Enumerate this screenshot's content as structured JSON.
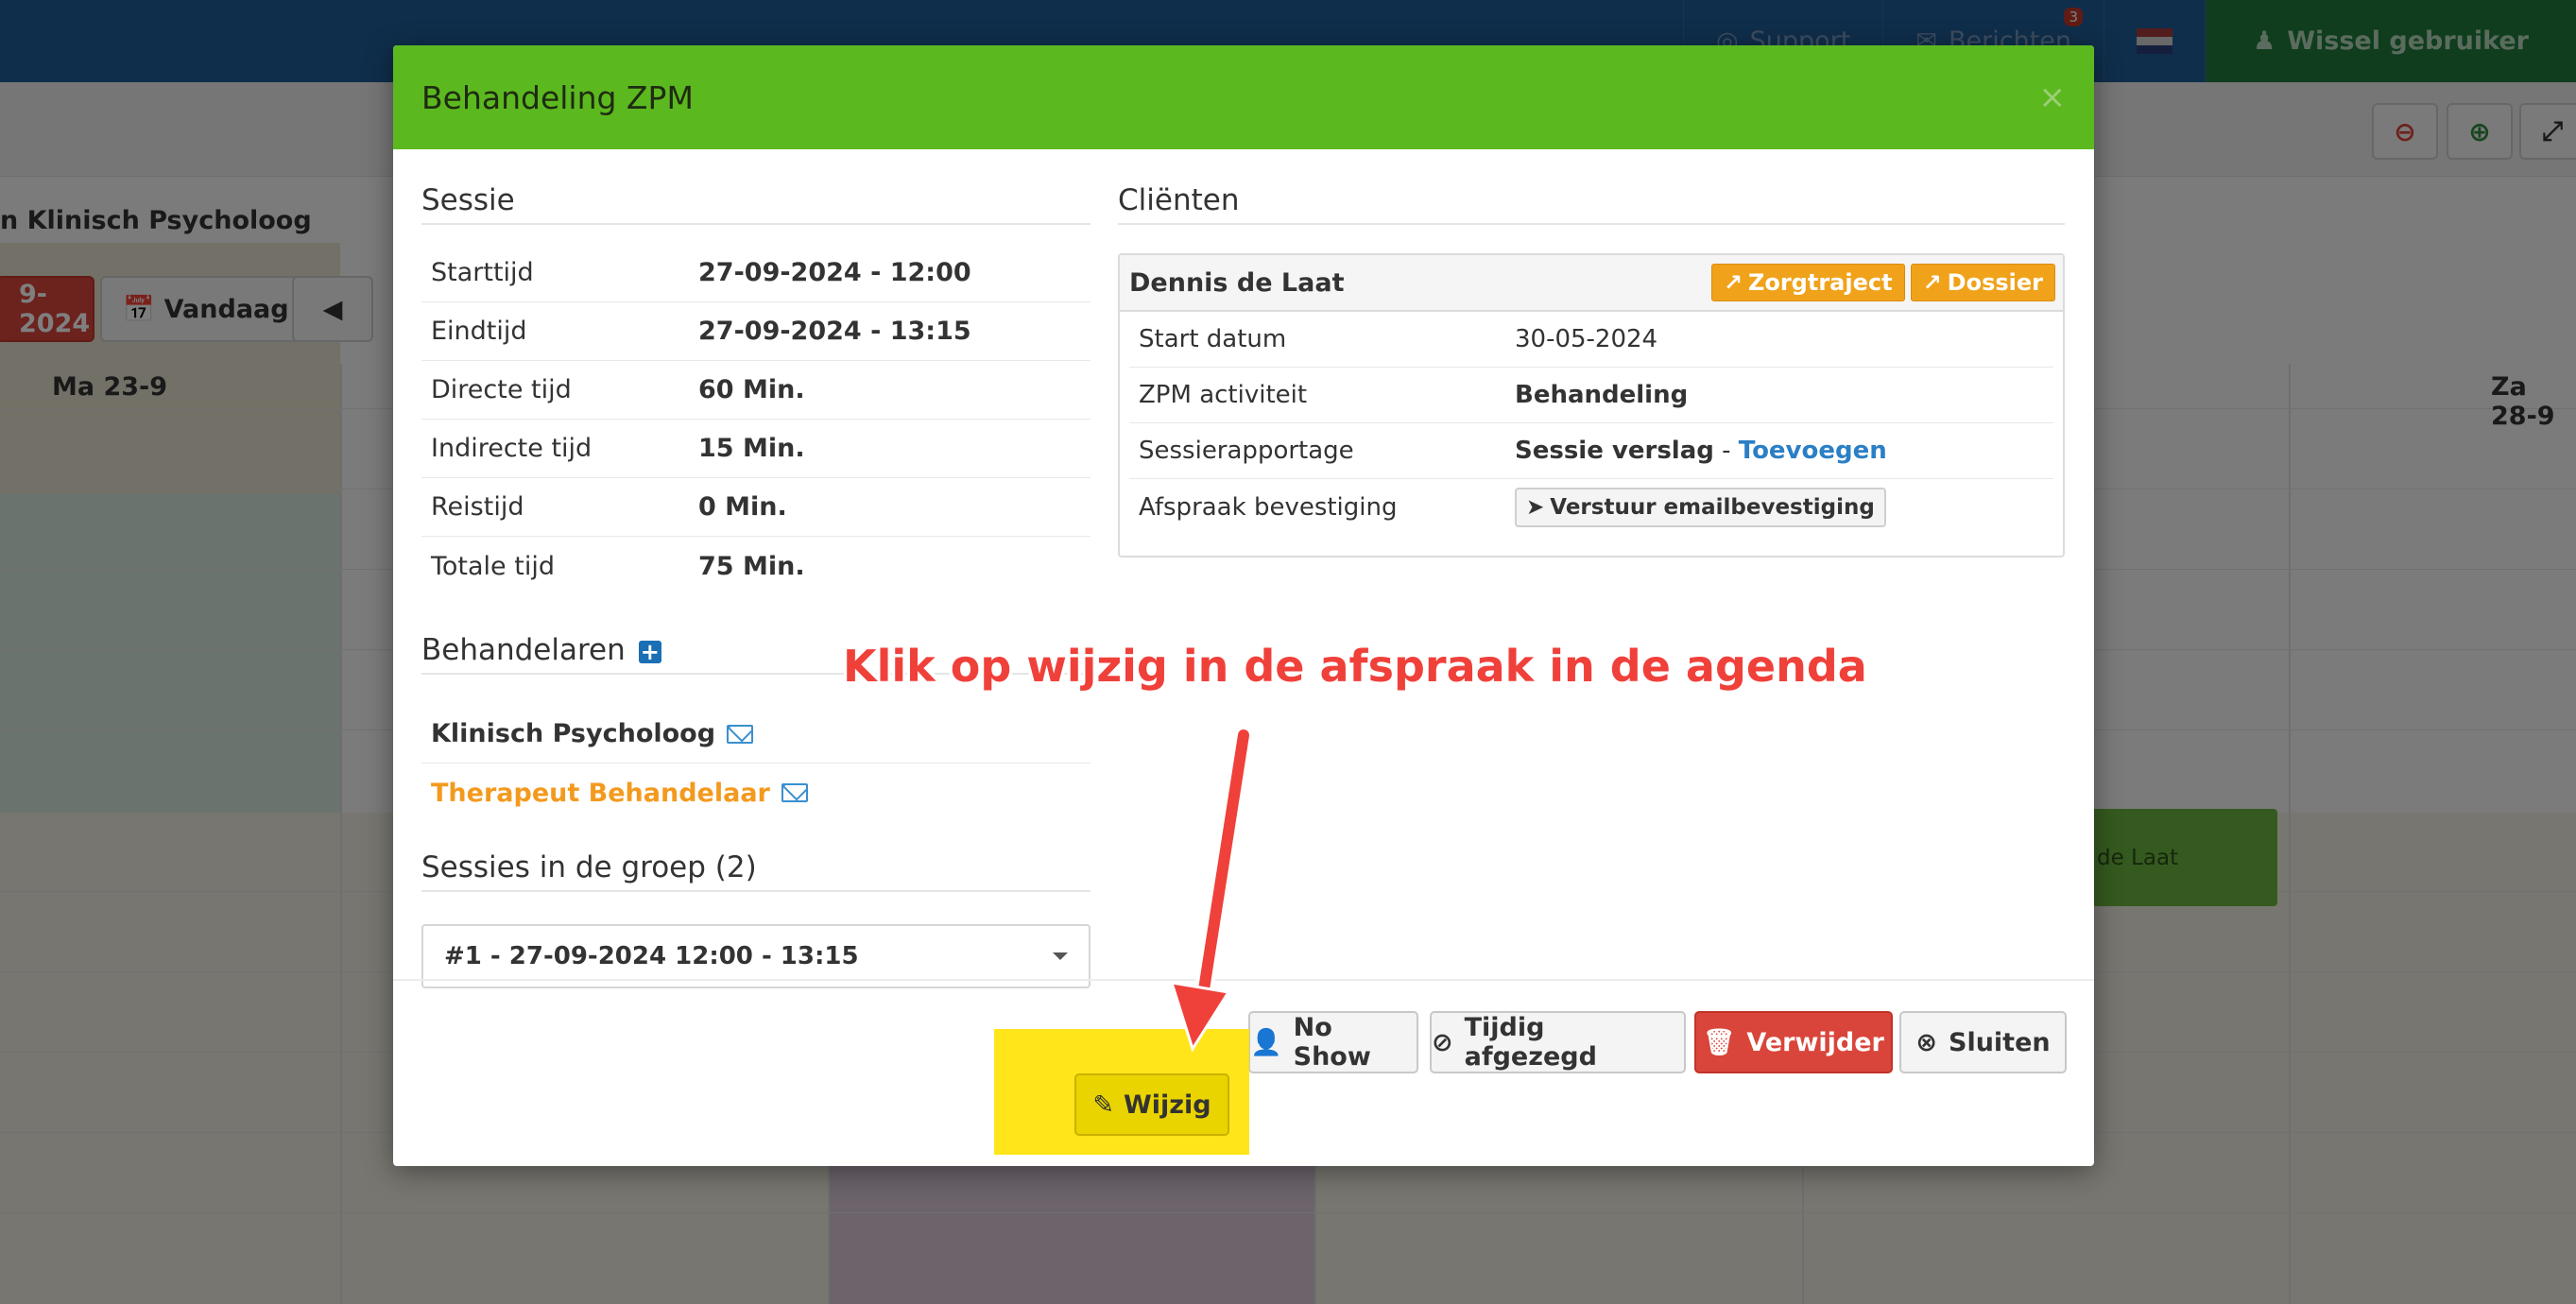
{
  "topnav": {
    "support": "Support",
    "messages": "Berichten",
    "messages_badge": "3",
    "switch_user": "Wissel gebruiker"
  },
  "calendar": {
    "title_fragment": "n Klinisch Psycholoog",
    "date_fragment": "9-2024",
    "today_button": "Vandaag",
    "day_first": "Ma 23-9",
    "day_last": "Za 28-9",
    "event_fragment": "de Laat"
  },
  "modal": {
    "title": "Behandeling ZPM",
    "close": "×",
    "session": {
      "heading": "Sessie",
      "rows": [
        {
          "label": "Starttijd",
          "value": "27-09-2024 - 12:00"
        },
        {
          "label": "Eindtijd",
          "value": "27-09-2024 - 13:15"
        },
        {
          "label": "Directe tijd",
          "value": "60 Min."
        },
        {
          "label": "Indirecte tijd",
          "value": "15 Min."
        },
        {
          "label": "Reistijd",
          "value": "0 Min."
        },
        {
          "label": "Totale tijd",
          "value": "75 Min."
        }
      ]
    },
    "treaters": {
      "heading": "Behandelaren",
      "items": [
        "Klinisch Psycholoog",
        "Therapeut Behandelaar"
      ]
    },
    "group_sessions": {
      "heading": "Sessies in de groep (2)",
      "selected": "#1 - 27-09-2024 12:00 - 13:15"
    },
    "clients": {
      "heading": "Cliënten",
      "name": "Dennis de Laat",
      "zorgtraject_button": "Zorgtraject",
      "dossier_button": "Dossier",
      "rows": {
        "start_label": "Start datum",
        "start_value": "30-05-2024",
        "activity_label": "ZPM activiteit",
        "activity_value": "Behandeling",
        "report_label": "Sessierapportage",
        "report_value": "Sessie verslag",
        "report_sep": " - ",
        "report_link": "Toevoegen",
        "confirm_label": "Afspraak bevestiging",
        "confirm_button": "Verstuur emailbevestiging"
      }
    },
    "footer": {
      "edit": "Wijzig",
      "no_show": "No Show",
      "cancelled": "Tijdig afgezegd",
      "delete": "Verwijder",
      "close": "Sluiten"
    }
  },
  "annotation": {
    "text": "Klik op wijzig in de afspraak in de agenda",
    "highlight_color": "#ffe200",
    "arrow_color": "#f0403a"
  },
  "colors": {
    "header_green": "#5cb81f",
    "topbar_blue": "#1e5d97",
    "orange": "#f0a21a",
    "danger": "#d9453a",
    "link_blue": "#2b7fc5",
    "treater_orange": "#f39a1e"
  }
}
